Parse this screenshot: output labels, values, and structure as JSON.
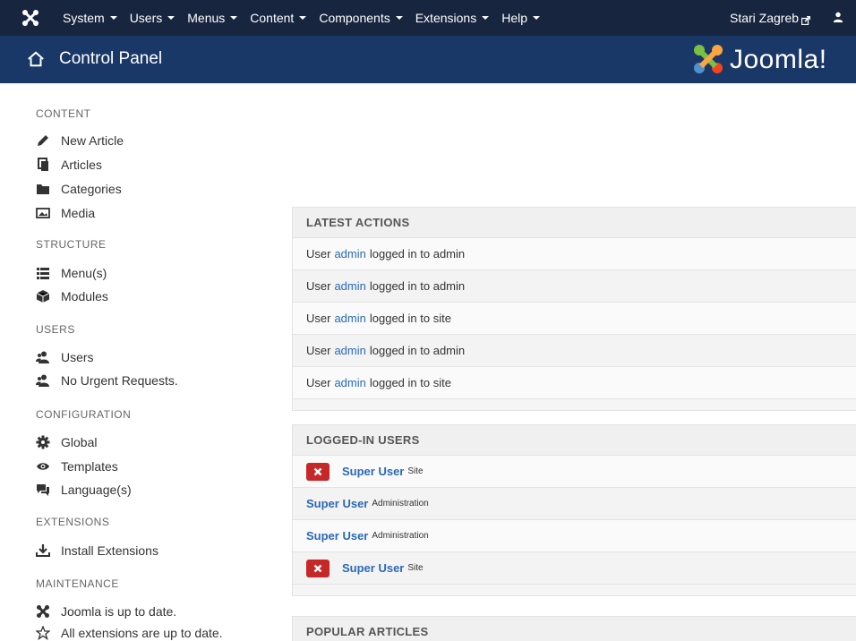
{
  "topbar": {
    "menu": [
      {
        "key": "system",
        "label": "System"
      },
      {
        "key": "users",
        "label": "Users"
      },
      {
        "key": "menus",
        "label": "Menus"
      },
      {
        "key": "content",
        "label": "Content"
      },
      {
        "key": "components",
        "label": "Components"
      },
      {
        "key": "extensions",
        "label": "Extensions"
      },
      {
        "key": "help",
        "label": "Help"
      }
    ],
    "site_name": "Stari Zagreb"
  },
  "header": {
    "title": "Control Panel",
    "brand": "Joomla!"
  },
  "sidebar": {
    "content": {
      "heading": "CONTENT",
      "items": [
        "New Article",
        "Articles",
        "Categories",
        "Media"
      ]
    },
    "structure": {
      "heading": "STRUCTURE",
      "items": [
        "Menu(s)",
        "Modules"
      ]
    },
    "users": {
      "heading": "USERS",
      "items": [
        "Users",
        "No Urgent Requests."
      ]
    },
    "configuration": {
      "heading": "CONFIGURATION",
      "items": [
        "Global",
        "Templates",
        "Language(s)"
      ]
    },
    "extensions": {
      "heading": "EXTENSIONS",
      "items": [
        "Install Extensions"
      ]
    },
    "maintenance": {
      "heading": "MAINTENANCE",
      "items": [
        "Joomla is up to date.",
        "All extensions are up to date."
      ]
    }
  },
  "latest_actions": {
    "heading": "LATEST ACTIONS",
    "rows": [
      {
        "prefix": "User",
        "user": "admin",
        "suffix": "logged in to admin"
      },
      {
        "prefix": "User",
        "user": "admin",
        "suffix": "logged in to admin"
      },
      {
        "prefix": "User",
        "user": "admin",
        "suffix": "logged in to site"
      },
      {
        "prefix": "User",
        "user": "admin",
        "suffix": "logged in to admin"
      },
      {
        "prefix": "User",
        "user": "admin",
        "suffix": "logged in to site"
      }
    ]
  },
  "logged_in_users": {
    "heading": "LOGGED-IN USERS",
    "rows": [
      {
        "name": "Super User",
        "context": "Site",
        "logout": true
      },
      {
        "name": "Super User",
        "context": "Administration",
        "logout": false
      },
      {
        "name": "Super User",
        "context": "Administration",
        "logout": false
      },
      {
        "name": "Super User",
        "context": "Site",
        "logout": true
      }
    ]
  },
  "popular_articles": {
    "heading": "POPULAR ARTICLES"
  },
  "colors": {
    "navbar": "#17253f",
    "header": "#1a3867",
    "link": "#2a69b8",
    "danger": "#c52827",
    "joomla_blue": "#5091cd",
    "joomla_green": "#7ac143",
    "joomla_orange": "#f9a541",
    "joomla_red": "#f44321"
  }
}
